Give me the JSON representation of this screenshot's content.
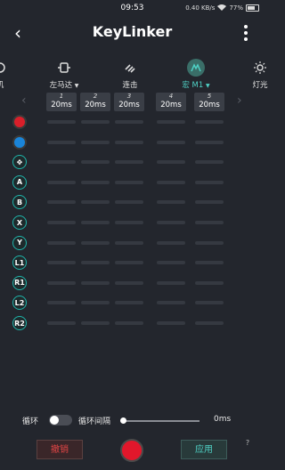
{
  "status": {
    "time": "09:53",
    "battery": "77%",
    "network": "0.40 KB/s"
  },
  "header": {
    "back_icon": "chevron-left-icon",
    "title": "KeyLinker",
    "menu_icon": "more-vertical-icon"
  },
  "toolbar": {
    "items": [
      {
        "label": "机",
        "icon": "partial-icon",
        "active": false
      },
      {
        "label": "左马达",
        "icon": "motor-icon",
        "active": false,
        "dropdown": true
      },
      {
        "label": "连击",
        "icon": "turbo-icon",
        "active": false
      },
      {
        "label": "宏 M1",
        "icon": "macro-icon",
        "active": true,
        "dropdown": true
      },
      {
        "label": "灯光",
        "icon": "light-icon",
        "active": false
      }
    ]
  },
  "columns": [
    {
      "num": "1",
      "delay": "20ms"
    },
    {
      "num": "2",
      "delay": "20ms"
    },
    {
      "num": "3",
      "delay": "20ms"
    },
    {
      "num": "4",
      "delay": "20ms"
    },
    {
      "num": "5",
      "delay": "20ms"
    }
  ],
  "buttons": [
    {
      "name": "red-button-icon",
      "label": "",
      "style": "red"
    },
    {
      "name": "blue-button-icon",
      "label": "",
      "style": "blue"
    },
    {
      "name": "dpad-icon",
      "label": "✥",
      "style": "teal"
    },
    {
      "name": "a-button-icon",
      "label": "A",
      "style": "teal"
    },
    {
      "name": "b-button-icon",
      "label": "B",
      "style": "teal"
    },
    {
      "name": "x-button-icon",
      "label": "X",
      "style": "teal"
    },
    {
      "name": "y-button-icon",
      "label": "Y",
      "style": "teal"
    },
    {
      "name": "l1-button-icon",
      "label": "L1",
      "style": "teal"
    },
    {
      "name": "r1-button-icon",
      "label": "R1",
      "style": "teal"
    },
    {
      "name": "l2-button-icon",
      "label": "L2",
      "style": "teal"
    },
    {
      "name": "r2-button-icon",
      "label": "R2",
      "style": "teal"
    }
  ],
  "loop": {
    "label": "循环",
    "enabled": false,
    "interval_label": "循环间隔",
    "interval_value": "0ms",
    "interval_fraction": 0
  },
  "actions": {
    "undo": "撤销",
    "apply": "应用",
    "help": "?"
  },
  "colors": {
    "accent": "#4fd1c5",
    "record": "#e2172b",
    "background": "#23262d"
  }
}
